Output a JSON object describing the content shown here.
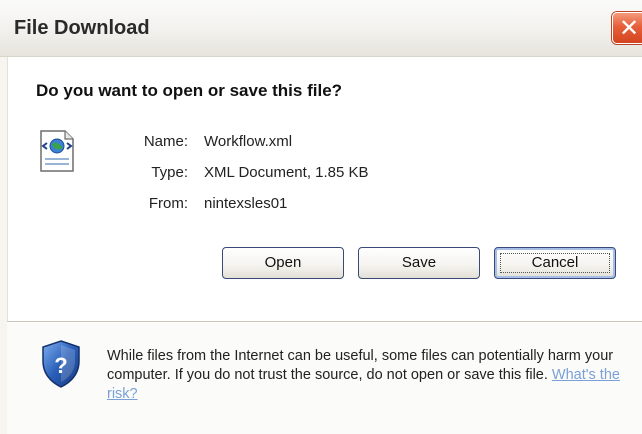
{
  "window": {
    "title": "File Download",
    "close_label": "✕"
  },
  "dialog": {
    "question": "Do you want to open or save this file?",
    "file_info": {
      "name_label": "Name:",
      "name_value": "Workflow.xml",
      "type_label": "Type:",
      "type_value": "XML Document, 1.85 KB",
      "from_label": "From:",
      "from_value": "nintexsles01"
    },
    "buttons": {
      "open_label": "Open",
      "save_label": "Save",
      "cancel_label": "Cancel"
    },
    "warning": {
      "text": "While files from the Internet can be useful, some files can potentially harm your computer. If you do not trust the source, do not open or save this file. ",
      "link_text": "What's the risk?"
    }
  },
  "icons": {
    "file": "xml-file-icon",
    "shield": "security-shield-icon",
    "close": "close-icon"
  },
  "colors": {
    "close_button": "#e6603a",
    "link": "#7aa0d8",
    "shield": "#2a5fb8",
    "button_border": "#3a4a78"
  }
}
